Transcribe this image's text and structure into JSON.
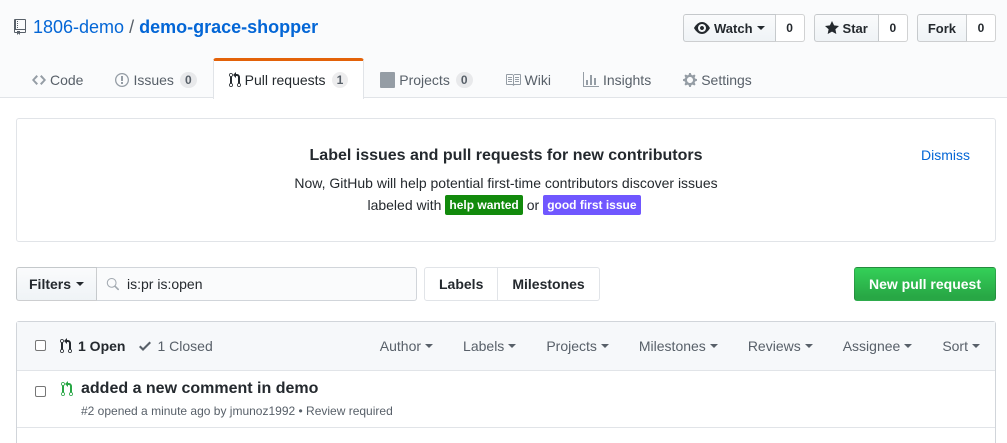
{
  "repo": {
    "owner": "1806-demo",
    "separator": "/",
    "name": "demo-grace-shopper",
    "icon": "repo-icon"
  },
  "actions": {
    "watch": {
      "label": "Watch",
      "count": "0",
      "icon": "eye-icon"
    },
    "star": {
      "label": "Star",
      "count": "0",
      "icon": "star-icon"
    },
    "fork": {
      "label": "Fork",
      "count": "0"
    }
  },
  "tabs": [
    {
      "label": "Code",
      "icon": "code-icon"
    },
    {
      "label": "Issues",
      "counter": "0",
      "icon": "issue-opened-icon"
    },
    {
      "label": "Pull requests",
      "counter": "1",
      "icon": "git-pull-request-icon",
      "selected": true
    },
    {
      "label": "Projects",
      "counter": "0",
      "icon": "project-icon"
    },
    {
      "label": "Wiki",
      "icon": "book-icon"
    },
    {
      "label": "Insights",
      "icon": "graph-icon"
    },
    {
      "label": "Settings",
      "icon": "gear-icon"
    }
  ],
  "banner": {
    "title": "Label issues and pull requests for new contributors",
    "line1": "Now, GitHub will help potential first-time contributors discover issues",
    "line2_prefix": "labeled with",
    "label_help": "help wanted",
    "label_help_color": "#128a0c",
    "connector": "or",
    "label_good": "good first issue",
    "label_good_color": "#7057ff",
    "dismiss": "Dismiss"
  },
  "subnav": {
    "filters_label": "Filters",
    "search_value": "is:pr is:open",
    "labels": "Labels",
    "milestones": "Milestones",
    "new_pr": "New pull request"
  },
  "list": {
    "open_count": "1 Open",
    "closed_count": "1 Closed",
    "filters": [
      "Author",
      "Labels",
      "Projects",
      "Milestones",
      "Reviews",
      "Assignee",
      "Sort"
    ],
    "items": [
      {
        "title": "added a new comment in demo",
        "meta": "#2 opened a minute ago by jmunoz1992 • Review required"
      }
    ]
  },
  "colors": {
    "link": "#0366d6",
    "accent_tab": "#e36209",
    "primary_button": "#28a745",
    "open_icon": "#28a745"
  }
}
